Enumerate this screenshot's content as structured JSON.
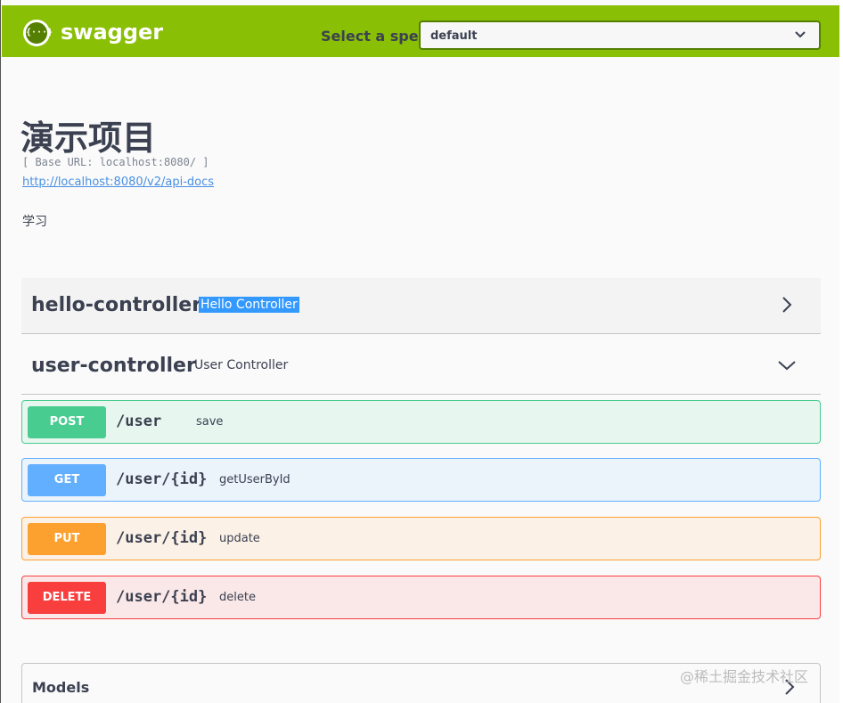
{
  "topbar": {
    "logo_glyph": "{···}",
    "brand": "swagger",
    "spec_label": "Select a spec",
    "spec_value": "default"
  },
  "info": {
    "title": "演示项目",
    "base_url": "[ Base URL: localhost:8080/ ]",
    "api_docs_link": "http://localhost:8080/v2/api-docs",
    "description": "学习"
  },
  "tags": [
    {
      "name": "hello-controller",
      "description": "Hello Controller",
      "expanded": false
    },
    {
      "name": "user-controller",
      "description": "User Controller",
      "expanded": true
    }
  ],
  "operations": [
    {
      "method": "POST",
      "path": "/user",
      "summary": "save",
      "color": "#49cc90"
    },
    {
      "method": "GET",
      "path": "/user/{id}",
      "summary": "getUserById",
      "color": "#61affe"
    },
    {
      "method": "PUT",
      "path": "/user/{id}",
      "summary": "update",
      "color": "#fca130"
    },
    {
      "method": "DELETE",
      "path": "/user/{id}",
      "summary": "delete",
      "color": "#f93e3e"
    }
  ],
  "models": {
    "label": "Models"
  },
  "watermark": "@稀土掘金技术社区",
  "colors": {
    "topbar": "#89bf04",
    "text": "#3b4151",
    "link": "#4990e2"
  }
}
